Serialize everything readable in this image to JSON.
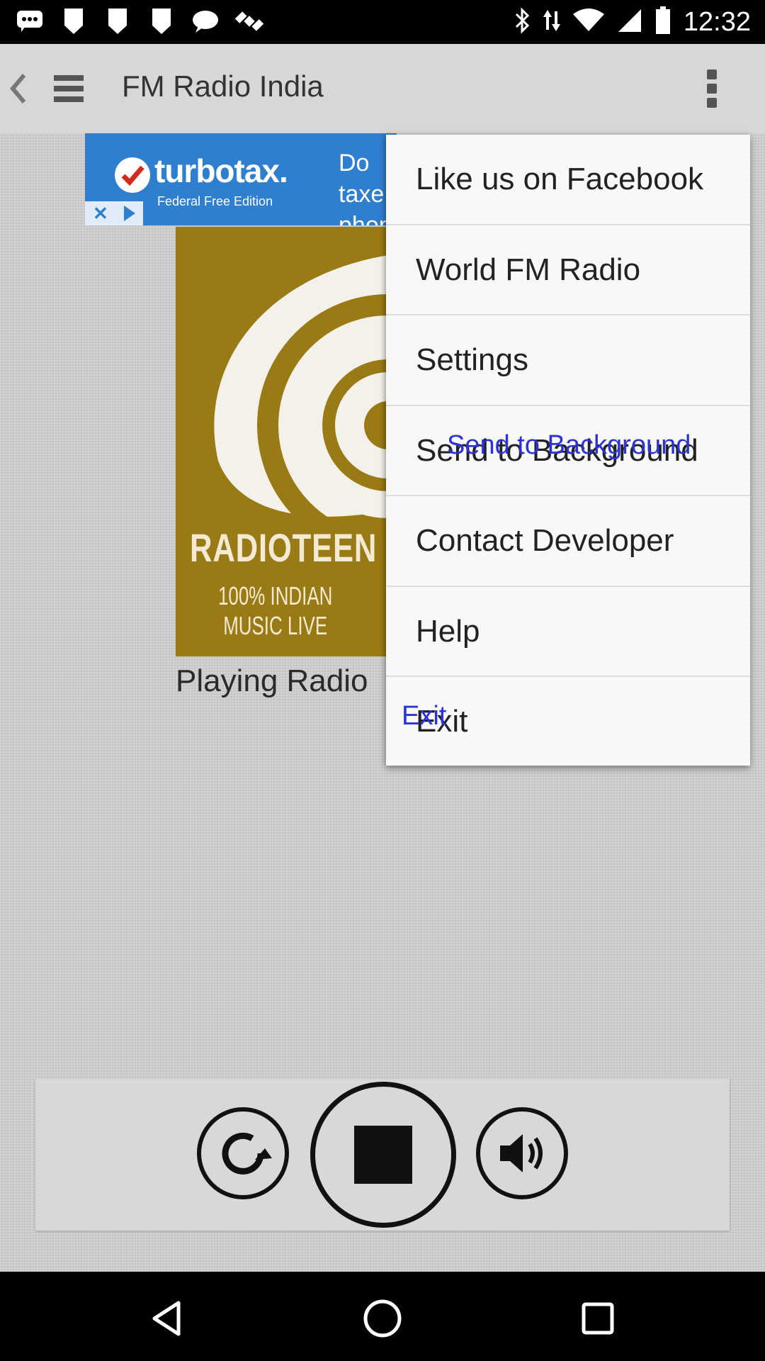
{
  "status_bar": {
    "time": "12:32",
    "icons": [
      "messages-icon",
      "alert-icon",
      "alert-icon",
      "alert-icon",
      "chat-icon",
      "gps-satellite-icon",
      "bluetooth-icon",
      "data-arrows-icon",
      "wifi-icon",
      "signal-icon",
      "battery-icon"
    ]
  },
  "app_bar": {
    "title": "FM Radio India",
    "back_icon": "chevron-left-icon",
    "menu_icon": "hamburger-menu-icon",
    "overflow_icon": "more-vert-icon"
  },
  "ad": {
    "brand": "turbotax.",
    "sub": "Federal Free Edition",
    "text_line1": "Do taxe",
    "text_line2": "phone",
    "brand_color": "#2f7fd1"
  },
  "station": {
    "logo_name": "RADIOTEEN",
    "tagline_line1": "100% INDIAN",
    "tagline_line2": "MUSIC LIVE",
    "logo_color": "#9a7a14"
  },
  "now_playing": "Playing Radio",
  "overflow_menu": {
    "items": [
      {
        "label": "Like us on Facebook"
      },
      {
        "label": "World FM Radio"
      },
      {
        "label": "Settings"
      },
      {
        "label": "Send to Background"
      },
      {
        "label": "Contact Developer"
      },
      {
        "label": "Help"
      },
      {
        "label": "Exit"
      }
    ],
    "overlay_send": "Send to Background",
    "overlay_exit": "Exit",
    "overlay_color": "#2b33d8"
  },
  "controls": {
    "refresh": "refresh-icon",
    "stop": "stop-icon",
    "volume": "volume-icon"
  },
  "nav_bar": {
    "back": "back-triangle-icon",
    "home": "home-circle-icon",
    "recents": "recents-square-icon"
  }
}
